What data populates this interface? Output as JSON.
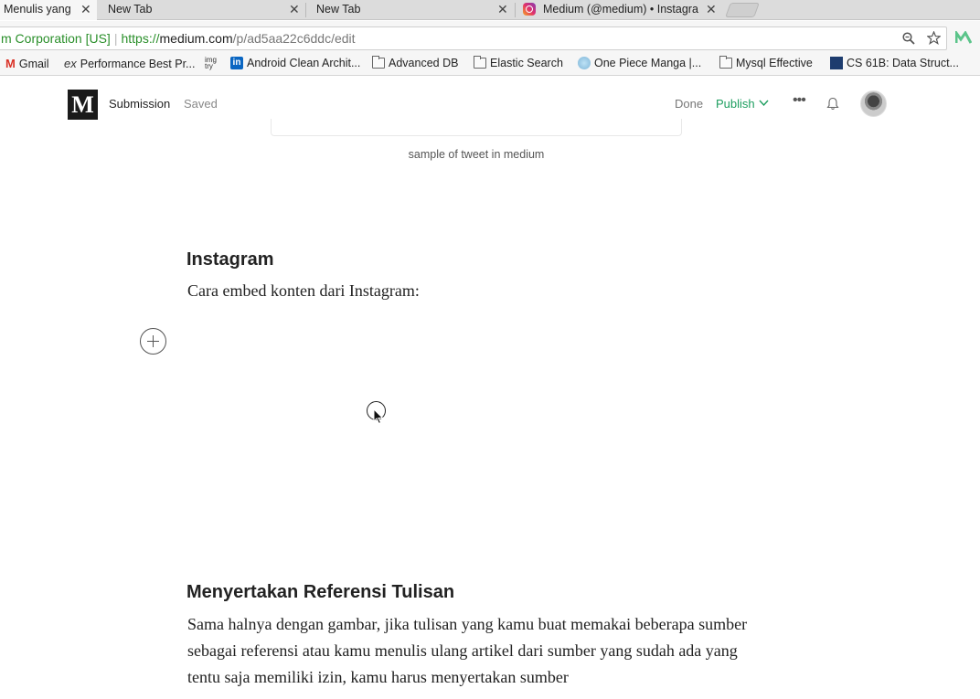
{
  "browser": {
    "tabs": [
      {
        "label": "Menulis yang",
        "active": true
      },
      {
        "label": "New Tab",
        "active": false
      },
      {
        "label": "New Tab",
        "active": false
      },
      {
        "label": "Medium (@medium) • Instagra",
        "active": false
      }
    ],
    "close_glyph": "✕",
    "address": {
      "ev_label": "m Corporation [US]",
      "scheme": "https://",
      "host": "medium.com",
      "path": "/p/ad5aa22c6ddc/edit"
    },
    "bookmarks": [
      {
        "label": "Gmail",
        "icon": "gmail-icon"
      },
      {
        "label": "Performance Best Pr...",
        "icon": "ex-icon"
      },
      {
        "label": "Android Clean Archit...",
        "icon": "linkedin-icon"
      },
      {
        "label": "Advanced DB",
        "icon": "folder-icon"
      },
      {
        "label": "Elastic Search",
        "icon": "folder-icon"
      },
      {
        "label": "One Piece Manga |...",
        "icon": "globe-icon"
      },
      {
        "label": "Mysql Effective",
        "icon": "folder-icon"
      },
      {
        "label": "CS 61B: Data Struct...",
        "icon": "cs-icon"
      }
    ],
    "accent_color": "#2a8f2a"
  },
  "editor": {
    "logo": "M",
    "submission": "Submission",
    "saved": "Saved",
    "done": "Done",
    "publish": "Publish",
    "more": "•••",
    "accent_color": "#1d9e5f"
  },
  "article": {
    "caption": "sample of tweet in medium",
    "instagram_heading": "Instagram",
    "instagram_paragraph": "Cara embed konten dari Instagram:",
    "ref_heading": "Menyertakan Referensi Tulisan",
    "ref_paragraph": "Sama halnya dengan gambar, jika tulisan yang kamu buat memakai beberapa sumber sebagai referensi atau kamu menulis ulang artikel dari sumber yang sudah ada yang tentu saja memiliki izin, kamu harus menyertakan sumber"
  }
}
